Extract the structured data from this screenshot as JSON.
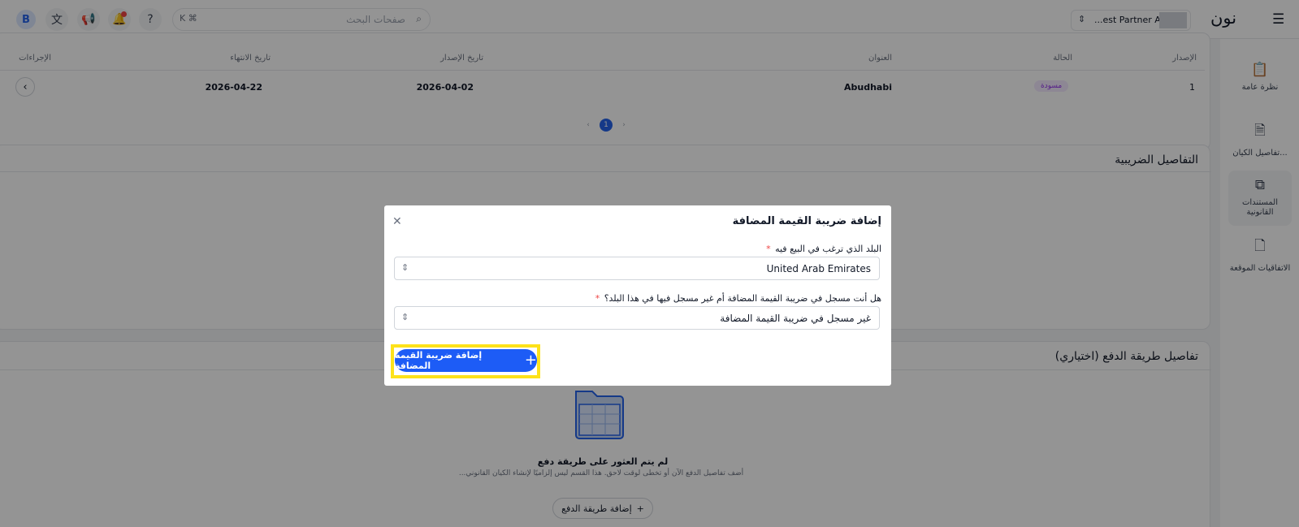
{
  "topbar": {
    "avatar_letter": "B",
    "search_placeholder": "صفحات البحث",
    "search_shortcut": "K ⌘",
    "partner_name": "...est Partner AE",
    "logo_text": "نون",
    "icons": [
      "translate-icon",
      "megaphone-icon",
      "bell-icon",
      "help-icon",
      "search-icon",
      "menu-icon"
    ]
  },
  "sidebar": {
    "items": [
      {
        "label": "نظرة عامة",
        "icon": "clipboard-icon"
      },
      {
        "label": "تفاصيل الكيان...",
        "icon": "entity-icon"
      },
      {
        "label": "المستندات القانونية",
        "icon": "documents-icon"
      },
      {
        "label": "الاتفاقيات الموقعة",
        "icon": "signed-doc-icon"
      }
    ]
  },
  "table": {
    "headers": {
      "version": "الإصدار",
      "status": "الحالة",
      "address": "العنوان",
      "issue_date": "تاريخ الإصدار",
      "expiry_date": "تاريخ الانتهاء",
      "actions": "الإجراءات"
    },
    "rows": [
      {
        "version": "1",
        "status": "مسودة",
        "address": "Abudhabi",
        "issue_date": "2026-04-02",
        "expiry_date": "2026-04-22"
      }
    ],
    "current_page": "1"
  },
  "tax_section": {
    "title": "التفاصيل الضريبية"
  },
  "payment_section": {
    "title": "تفاصيل طريقة الدفع (اختياري)",
    "empty_title": "لم يتم العثور على طريقة دفع",
    "empty_subtitle": "أضف تفاصيل الدفع الآن أو تخطى لوقت لاحق. هذا القسم ليس إلزاميًا لإنشاء الكيان القانوني...",
    "add_button": "إضافة طريقة الدفع"
  },
  "modal": {
    "title": "إضافة ضريبة القيمة المضافة",
    "country_label": "البلد الذي ترغب في البيع فيه",
    "country_value": "United Arab Emirates",
    "vat_label": "هل أنت مسجل في ضريبة القيمة المضافة أم غير مسجل فيها في هذا البلد؟",
    "vat_value": "غير مسجل في ضريبة القيمة المضافة",
    "required_mark": "*",
    "submit_button": "إضافة ضريبة القيمة المضافة"
  },
  "colors": {
    "primary": "#1d5cf6",
    "highlight": "#fde21a",
    "draft": "#9333ea"
  }
}
